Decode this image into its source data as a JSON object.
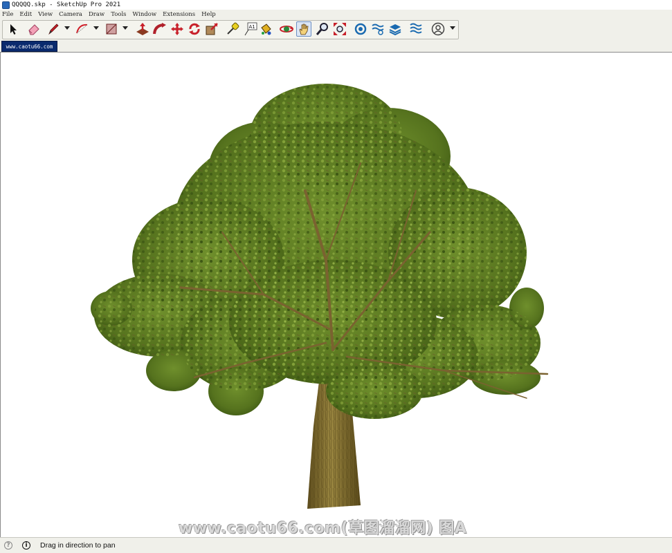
{
  "window": {
    "title": "QQQQQ.skp - SketchUp Pro 2021"
  },
  "menu": [
    "File",
    "Edit",
    "View",
    "Camera",
    "Draw",
    "Tools",
    "Window",
    "Extensions",
    "Help"
  ],
  "toolbar": {
    "tools": [
      {
        "name": "select-tool",
        "icon": "arrow-cursor-icon"
      },
      {
        "name": "eraser-tool",
        "icon": "eraser-icon"
      },
      {
        "name": "line-tool",
        "icon": "pencil-icon"
      },
      {
        "name": "arc-tool",
        "icon": "arc-icon"
      },
      {
        "name": "rectangle-tool",
        "icon": "rectangle-icon"
      },
      {
        "name": "push-pull-tool",
        "icon": "push-pull-icon"
      },
      {
        "name": "follow-me-tool",
        "icon": "follow-me-icon"
      },
      {
        "name": "move-tool",
        "icon": "move-icon"
      },
      {
        "name": "rotate-tool",
        "icon": "rotate-icon"
      },
      {
        "name": "scale-tool",
        "icon": "scale-icon"
      },
      {
        "name": "tape-measure-tool",
        "icon": "tape-measure-icon"
      },
      {
        "name": "text-tool",
        "icon": "text-icon",
        "label": "A1"
      },
      {
        "name": "paint-bucket-tool",
        "icon": "paint-bucket-icon"
      },
      {
        "name": "orbit-tool",
        "icon": "orbit-icon"
      },
      {
        "name": "pan-tool",
        "icon": "hand-icon",
        "active": true
      },
      {
        "name": "zoom-tool",
        "icon": "magnifier-icon"
      },
      {
        "name": "zoom-extents-tool",
        "icon": "zoom-extents-icon"
      },
      {
        "name": "3d-warehouse-button",
        "icon": "warehouse-icon"
      },
      {
        "name": "extension-warehouse-button",
        "icon": "extension-warehouse-icon"
      },
      {
        "name": "layout-button",
        "icon": "layout-icon"
      },
      {
        "name": "extension-manager-button",
        "icon": "extension-manager-icon"
      },
      {
        "name": "account-button",
        "icon": "user-icon"
      }
    ]
  },
  "scene_tab": {
    "label": "www.caotu66.com"
  },
  "watermark": {
    "text": "www.caotu66.com(草图溜溜网) 图A"
  },
  "status": {
    "text": "Drag in direction to pan"
  },
  "colors": {
    "accent_blue": "#0a2a6e",
    "foliage": "#5a7a22",
    "trunk": "#7d6a2c"
  }
}
